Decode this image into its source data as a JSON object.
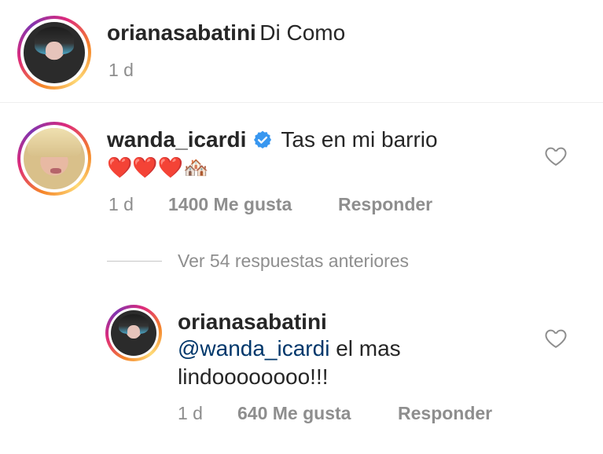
{
  "comments": [
    {
      "username": "orianasabatini",
      "text": "Di Como",
      "time": "1 d"
    },
    {
      "username": "wanda_icardi",
      "verified": true,
      "text": "Tas en mi barrio",
      "emojis": "❤️❤️❤️🏘️",
      "time": "1 d",
      "likes": "1400 Me gusta",
      "reply_label": "Responder"
    }
  ],
  "view_replies": "Ver 54 respuestas anteriores",
  "reply": {
    "username": "orianasabatini",
    "mention": "@wanda_icardi",
    "text_after_mention": " el mas",
    "text_line2": "lindoooooooo!!!",
    "time": "1 d",
    "likes": "640 Me gusta",
    "reply_label": "Responder"
  },
  "icons": {
    "like": "heart-outline-icon",
    "verified": "verified-badge-icon"
  },
  "colors": {
    "mention": "#00376b",
    "verified": "#3897f0",
    "meta": "#8e8e8e"
  }
}
